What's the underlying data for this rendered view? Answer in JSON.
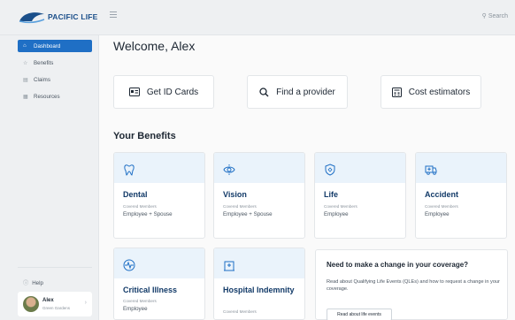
{
  "brand": {
    "logo_text": "PACIFIC LIFE"
  },
  "search": {
    "label": "Search"
  },
  "sidebar": {
    "items": [
      {
        "label": "Dashboard",
        "icon": "home-icon",
        "active": true
      },
      {
        "label": "Benefits",
        "icon": "star-icon",
        "active": false
      },
      {
        "label": "Claims",
        "icon": "document-icon",
        "active": false
      },
      {
        "label": "Resources",
        "icon": "book-icon",
        "active": false
      }
    ],
    "help_label": "Help",
    "user": {
      "name": "Alex",
      "subtitle": "Green Gardens"
    }
  },
  "main": {
    "welcome": "Welcome, Alex",
    "actions": [
      {
        "label": "Get ID Cards",
        "icon": "id-card-icon"
      },
      {
        "label": "Find a provider",
        "icon": "search-icon"
      },
      {
        "label": "Cost estimators",
        "icon": "calculator-icon"
      }
    ],
    "benefits_title": "Your Benefits",
    "benefits": [
      {
        "title": "Dental",
        "icon": "tooth-icon",
        "covered_label": "Covered Members",
        "covered_value": "Employee + Spouse"
      },
      {
        "title": "Vision",
        "icon": "eye-icon",
        "covered_label": "Covered Members",
        "covered_value": "Employee + Spouse"
      },
      {
        "title": "Life",
        "icon": "shield-icon",
        "covered_label": "Covered Members",
        "covered_value": "Employee"
      },
      {
        "title": "Accident",
        "icon": "ambulance-icon",
        "covered_label": "Covered Members",
        "covered_value": "Employee"
      },
      {
        "title": "Critical Illness",
        "icon": "heartbeat-icon",
        "covered_label": "Covered Members",
        "covered_value": "Employee"
      },
      {
        "title": "Hospital Indemnity",
        "icon": "hospital-icon",
        "covered_label": "Covered Members",
        "covered_value": ""
      }
    ],
    "coverage_change": {
      "title": "Need to make a change in your coverage?",
      "text": "Read about Qualifying Life Events (QLEs) and how to request a change in your coverage.",
      "button": "Read about life events"
    }
  },
  "colors": {
    "accent": "#1f6fc5",
    "card_band": "#eaf3fb",
    "title_blue": "#123a68"
  }
}
